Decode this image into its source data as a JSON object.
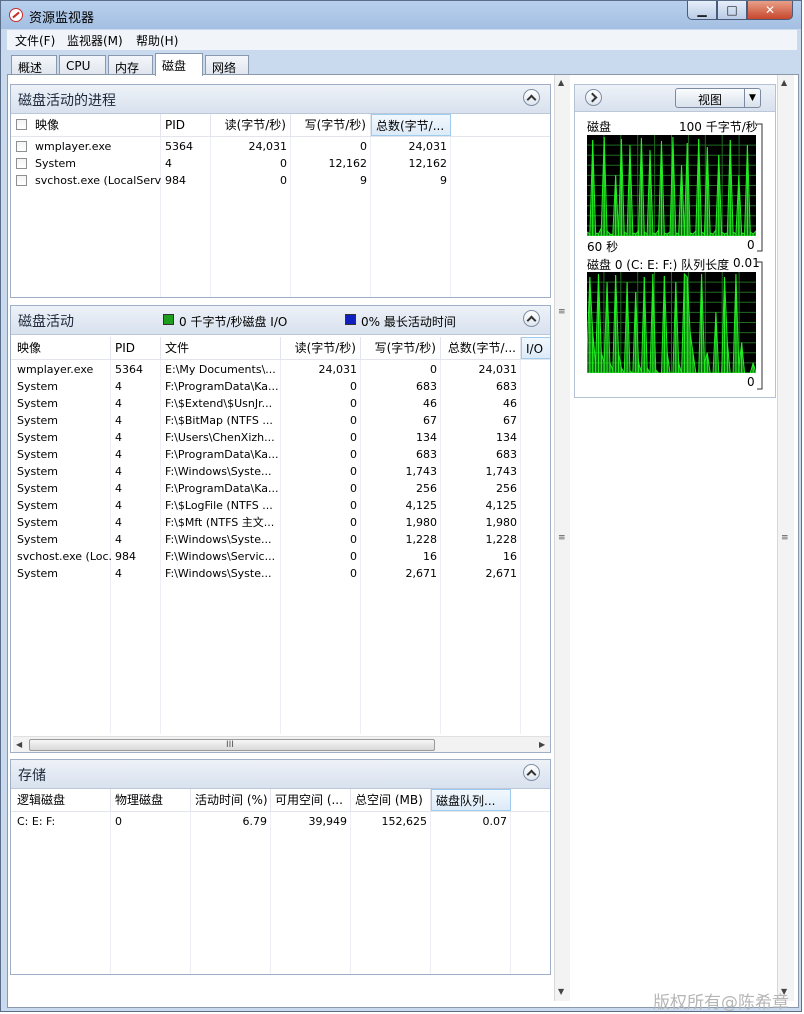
{
  "window": {
    "title": "资源监视器",
    "minimize": "▁",
    "maximize": "□",
    "close": "✕"
  },
  "menu": [
    "文件(F)",
    "监视器(M)",
    "帮助(H)"
  ],
  "tabs": [
    "概述",
    "CPU",
    "内存",
    "磁盘",
    "网络"
  ],
  "active_tab": "磁盘",
  "processes": {
    "title": "磁盘活动的进程",
    "columns": [
      "映像",
      "PID",
      "读(字节/秒)",
      "写(字节/秒)",
      "总数(字节/..."
    ],
    "rows": [
      [
        "wmplayer.exe",
        "5364",
        "24,031",
        "0",
        "24,031"
      ],
      [
        "System",
        "4",
        "0",
        "12,162",
        "12,162"
      ],
      [
        "svchost.exe (LocalServ...",
        "984",
        "0",
        "9",
        "9"
      ]
    ]
  },
  "activity": {
    "title": "磁盘活动",
    "legend_io": "0 千字节/秒磁盘 I/O",
    "legend_active": "0% 最长活动时间",
    "columns": [
      "映像",
      "PID",
      "文件",
      "读(字节/秒)",
      "写(字节/秒)",
      "总数(字节/...",
      "I/O"
    ],
    "rows": [
      [
        "wmplayer.exe",
        "5364",
        "E:\\My Documents\\...",
        "24,031",
        "0",
        "24,031"
      ],
      [
        "System",
        "4",
        "F:\\ProgramData\\Ka...",
        "0",
        "683",
        "683"
      ],
      [
        "System",
        "4",
        "F:\\$Extend\\$UsnJr...",
        "0",
        "46",
        "46"
      ],
      [
        "System",
        "4",
        "F:\\$BitMap (NTFS ...",
        "0",
        "67",
        "67"
      ],
      [
        "System",
        "4",
        "F:\\Users\\ChenXizh...",
        "0",
        "134",
        "134"
      ],
      [
        "System",
        "4",
        "F:\\ProgramData\\Ka...",
        "0",
        "683",
        "683"
      ],
      [
        "System",
        "4",
        "F:\\Windows\\Syste...",
        "0",
        "1,743",
        "1,743"
      ],
      [
        "System",
        "4",
        "F:\\ProgramData\\Ka...",
        "0",
        "256",
        "256"
      ],
      [
        "System",
        "4",
        "F:\\$LogFile (NTFS ...",
        "0",
        "4,125",
        "4,125"
      ],
      [
        "System",
        "4",
        "F:\\$Mft (NTFS 主文...",
        "0",
        "1,980",
        "1,980"
      ],
      [
        "System",
        "4",
        "F:\\Windows\\Syste...",
        "0",
        "1,228",
        "1,228"
      ],
      [
        "svchost.exe (Loc...",
        "984",
        "F:\\Windows\\Servic...",
        "0",
        "16",
        "16"
      ],
      [
        "System",
        "4",
        "F:\\Windows\\Syste...",
        "0",
        "2,671",
        "2,671"
      ]
    ],
    "scroll_grip": "III",
    "colors": {
      "io": "#1e9e1e",
      "active": "#1020c0"
    }
  },
  "storage": {
    "title": "存储",
    "columns": [
      "逻辑磁盘",
      "物理磁盘",
      "活动时间 (%)",
      "可用空间 (...",
      "总空间 (MB)",
      "磁盘队列..."
    ],
    "rows": [
      [
        "C: E: F:",
        "0",
        "6.79",
        "39,949",
        "152,625",
        "0.07"
      ]
    ]
  },
  "side": {
    "view_label": "视图",
    "graph1": {
      "label": "磁盘",
      "scale": "100 千字节/秒",
      "time": "60 秒",
      "min": "0"
    },
    "graph2": {
      "label": "磁盘 0 (C: E: F:) 队列长度",
      "scale": "0.01",
      "min": "0"
    }
  },
  "scroll_grip_v": "≡",
  "watermark": "版权所有@陈希章",
  "chart_data": [
    {
      "type": "area",
      "title": "磁盘",
      "ylabel": "100 千字节/秒",
      "xlabel": "60 秒",
      "ylim": [
        0,
        100
      ],
      "series": [
        {
          "values": [
            4,
            2,
            95,
            3,
            2,
            8,
            98,
            5,
            2,
            1,
            60,
            3,
            96,
            4,
            2,
            90,
            3,
            2,
            5,
            97,
            4,
            2,
            85,
            3,
            2,
            6,
            94,
            3,
            2,
            4,
            98,
            3,
            2,
            70,
            4,
            92,
            3,
            2,
            5,
            96,
            4,
            2,
            88,
            3,
            2,
            6,
            80,
            4,
            2,
            3,
            95,
            4,
            2,
            60,
            3,
            2,
            90,
            4,
            2,
            5
          ]
        }
      ],
      "color": "#22ee22"
    },
    {
      "type": "area",
      "title": "磁盘 0 (C: E: F:) 队列长度",
      "ylim": [
        0,
        0.01
      ],
      "series": [
        {
          "values": [
            0.002,
            0.0095,
            0.004,
            0.001,
            0.0098,
            0.002,
            0.001,
            0.009,
            0.001,
            0.0003,
            0.0097,
            0.002,
            0.0005,
            0.0,
            0.009,
            0.0002,
            0.0,
            0.008,
            0.001,
            0.0001,
            0.0095,
            0.0005,
            0.0,
            0.0098,
            0.0003,
            0.0,
            0.0,
            0.0096,
            0.002,
            0.0,
            0.0,
            0.009,
            0.001,
            0.0,
            0.0098,
            0.0095,
            0.004,
            0.002,
            0.0,
            0.0,
            0.0098,
            0.001,
            0.002,
            0.0,
            0.0,
            0.006,
            0.0,
            0.0,
            0.0095,
            0.003,
            0.0,
            0.0,
            0.0098,
            0.0005,
            0.003,
            0.0,
            0.0,
            0.0,
            0.001,
            0.0
          ]
        }
      ],
      "color": "#22ee22"
    }
  ]
}
